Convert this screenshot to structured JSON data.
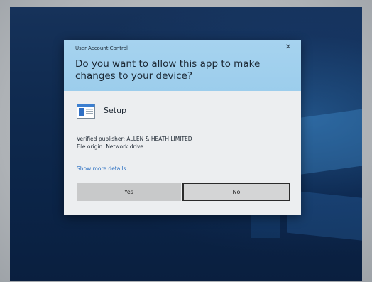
{
  "dialog": {
    "window_title": "User Account Control",
    "question": "Do you want to allow this app to make changes to your device?",
    "app_name": "Setup",
    "app_icon": "setup-app-icon",
    "publisher_line": "Verified publisher: ALLEN & HEATH LIMITED",
    "origin_line": "File origin: Network drive",
    "more_details_link": "Show more details",
    "yes_label": "Yes",
    "no_label": "No",
    "close_symbol": "✕"
  },
  "colors": {
    "header": "#9ccdec",
    "body": "#eceef0",
    "link": "#2a6fc2",
    "desktop": "#0f2a4f"
  }
}
